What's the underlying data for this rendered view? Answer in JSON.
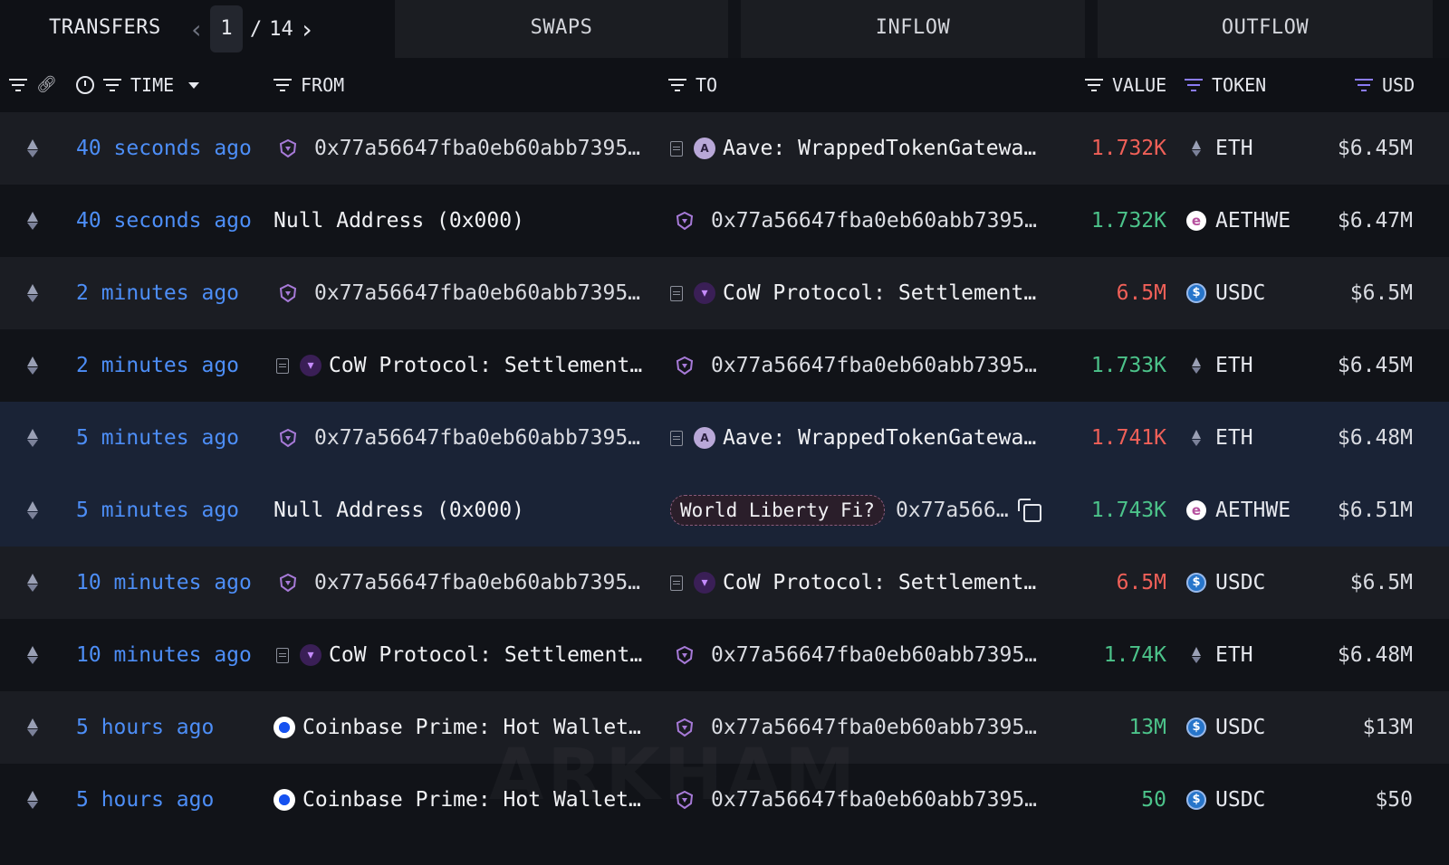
{
  "tabs": {
    "transfers": "TRANSFERS",
    "swaps": "SWAPS",
    "inflow": "INFLOW",
    "outflow": "OUTFLOW"
  },
  "pager": {
    "current": "1",
    "separator": "/",
    "total": "14"
  },
  "columns": {
    "time": "TIME",
    "from": "FROM",
    "to": "TO",
    "value": "VALUE",
    "token": "TOKEN",
    "usd": "USD"
  },
  "watermark": "ARKHAM",
  "colors": {
    "positive": "#4cc38a",
    "negative": "#f06058",
    "time_link": "#4d8ef7",
    "accent": "#8b7cf6"
  },
  "rows": [
    {
      "time": "40 seconds ago",
      "from": "0x77a56647fba0eb60abb7395…",
      "to": "Aave: WrappedTokenGatewa…",
      "value": "1.732K",
      "token": "ETH",
      "usd": "$6.45M"
    },
    {
      "time": "40 seconds ago",
      "from": "Null Address (0x000)",
      "to": "0x77a56647fba0eb60abb7395…",
      "value": "1.732K",
      "token": "AETHWE",
      "usd": "$6.47M"
    },
    {
      "time": "2 minutes ago",
      "from": "0x77a56647fba0eb60abb7395…",
      "to": "CoW Protocol: Settlement…",
      "value": "6.5M",
      "token": "USDC",
      "usd": "$6.5M"
    },
    {
      "time": "2 minutes ago",
      "from": "CoW Protocol: Settlement…",
      "to": "0x77a56647fba0eb60abb7395…",
      "value": "1.733K",
      "token": "ETH",
      "usd": "$6.45M"
    },
    {
      "time": "5 minutes ago",
      "from": "0x77a56647fba0eb60abb7395…",
      "to": "Aave: WrappedTokenGatewa…",
      "value": "1.741K",
      "token": "ETH",
      "usd": "$6.48M"
    },
    {
      "time": "5 minutes ago",
      "from": "Null Address (0x000)",
      "to_tag": "World Liberty Fi?",
      "to": "0x77a566…",
      "value": "1.743K",
      "token": "AETHWE",
      "usd": "$6.51M"
    },
    {
      "time": "10 minutes ago",
      "from": "0x77a56647fba0eb60abb7395…",
      "to": "CoW Protocol: Settlement…",
      "value": "6.5M",
      "token": "USDC",
      "usd": "$6.5M"
    },
    {
      "time": "10 minutes ago",
      "from": "CoW Protocol: Settlement…",
      "to": "0x77a56647fba0eb60abb7395…",
      "value": "1.74K",
      "token": "ETH",
      "usd": "$6.48M"
    },
    {
      "time": "5 hours ago",
      "from": "Coinbase Prime: Hot Wallet…",
      "to": "0x77a56647fba0eb60abb7395…",
      "value": "13M",
      "token": "USDC",
      "usd": "$13M"
    },
    {
      "time": "5 hours ago",
      "from": "Coinbase Prime: Hot Wallet…",
      "to": "0x77a56647fba0eb60abb7395…",
      "value": "50",
      "token": "USDC",
      "usd": "$50"
    }
  ]
}
